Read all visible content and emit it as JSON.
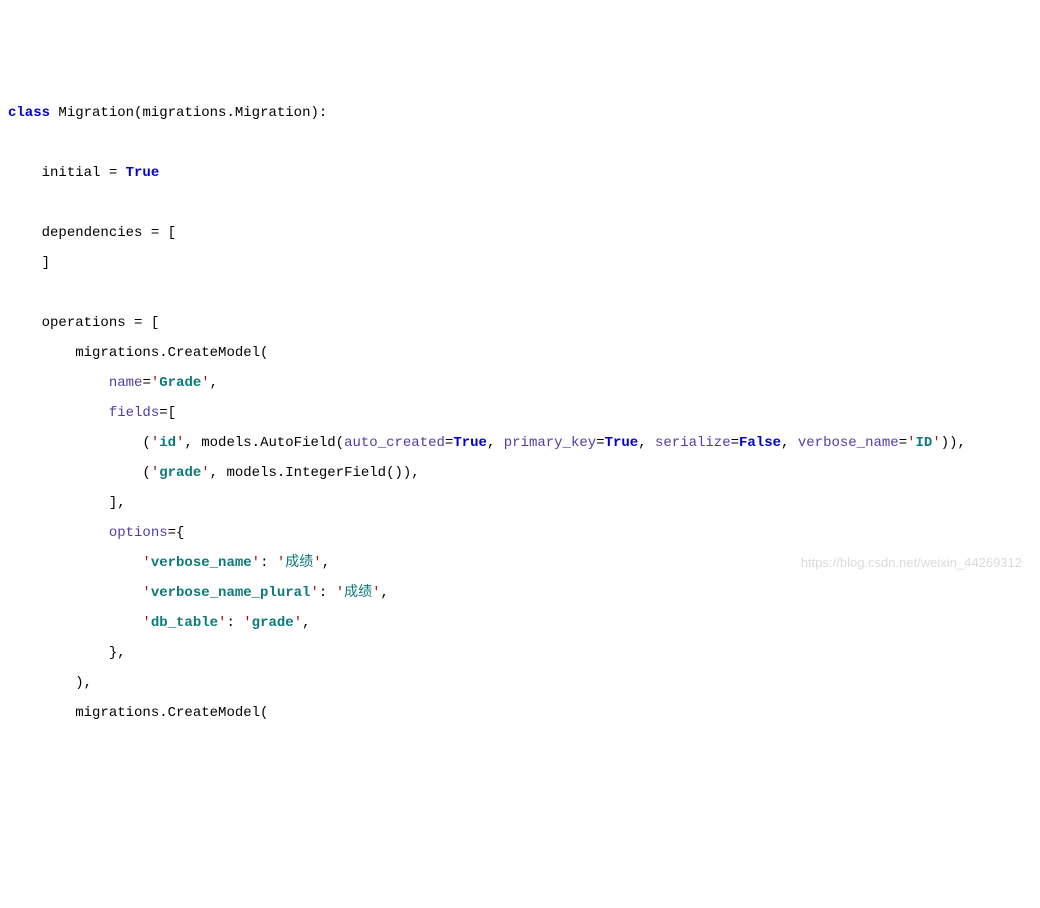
{
  "code": {
    "kw_class": "class",
    "class_name": "Migration",
    "base": "(migrations.Migration):",
    "initial_lhs": "initial = ",
    "true": "True",
    "false": "False",
    "deps_open": "dependencies = [",
    "deps_close": "]",
    "ops_open": "operations = [",
    "create_model": "migrations.CreateModel(",
    "name_kw": "name",
    "eq": "=",
    "sq": "'",
    "grade": "Grade",
    "comma": ",",
    "fields_kw": "fields",
    "fields_open": "=[",
    "id": "id",
    "autofield_prefix": ", models.AutoField(",
    "auto_created_kw": "auto_created",
    "primary_key_kw": "primary_key",
    "serialize_kw": "serialize",
    "verbose_name_kw": "verbose_name",
    "id_str": "ID",
    "close_paren2": ")),",
    "grade_field": "grade",
    "intfield": ", models.IntegerField()),",
    "fields_close": "],",
    "options_kw": "options",
    "options_open": "={",
    "opt_verbose_name": "verbose_name",
    "opt_verbose_name_val": "成绩",
    "opt_verbose_name_plural": "verbose_name_plural",
    "opt_db_table": "db_table",
    "opt_db_table_val": "grade",
    "colon_sp": ": ",
    "options_close": "},",
    "model_close": "),",
    "sep": ", "
  },
  "watermark": "https://blog.csdn.net/weixin_44269312"
}
